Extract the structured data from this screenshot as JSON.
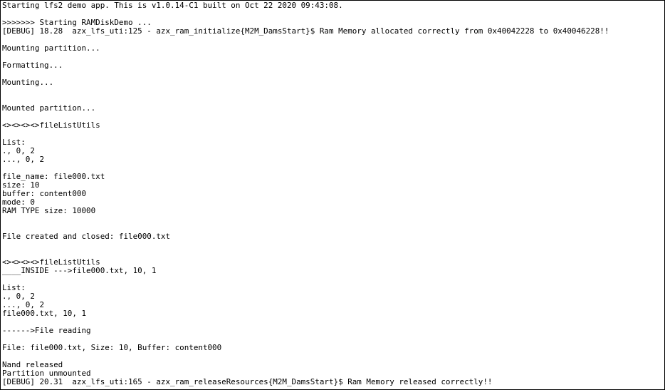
{
  "terminal": {
    "lines": [
      "Starting lfs2 demo app. This is v1.0.14-C1 built on Oct 22 2020 09:43:08.",
      "",
      ">>>>>>> Starting RAMDiskDemo ...",
      "[DEBUG] 18.28  azx_lfs_uti:125 - azx_ram_initialize{M2M_DamsStart}$ Ram Memory allocated correctly from 0x40042228 to 0x40046228!!",
      "",
      "Mounting partition...",
      "",
      "Formatting...",
      "",
      "Mounting...",
      "",
      "",
      "Mounted partition...",
      "",
      "<><><><>fileListUtils",
      "",
      "List:",
      "., 0, 2",
      "..., 0, 2",
      "",
      "file_name: file000.txt",
      "size: 10",
      "buffer: content000",
      "mode: 0",
      "RAM TYPE size: 10000",
      "",
      "",
      "File created and closed: file000.txt",
      "",
      "",
      "<><><><>fileListUtils",
      "____INSIDE --->file000.txt, 10, 1",
      "",
      "List:",
      "., 0, 2",
      "..., 0, 2",
      "file000.txt, 10, 1",
      "",
      "------>File reading",
      "",
      "File: file000.txt, Size: 10, Buffer: content000",
      "",
      "Nand released",
      "Partition unmounted",
      "[DEBUG] 20.31  azx_lfs_uti:165 - azx_ram_releaseResources{M2M_DamsStart}$ Ram Memory released correctly!!"
    ]
  }
}
